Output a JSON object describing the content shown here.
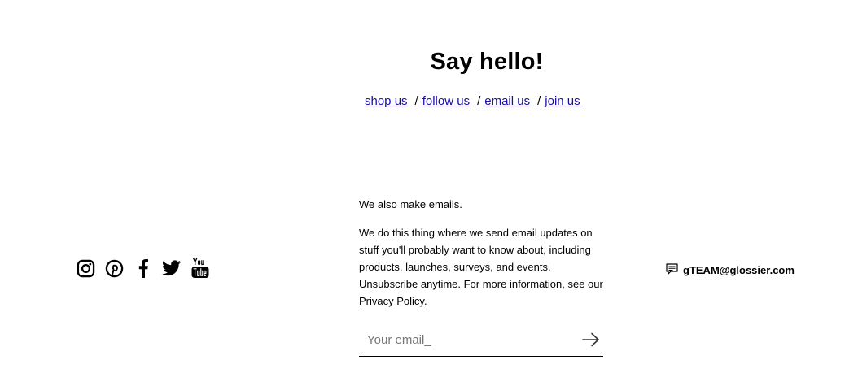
{
  "heading": "Say hello!",
  "nav": {
    "items": [
      {
        "label": "shop us"
      },
      {
        "label": "follow us"
      },
      {
        "label": "email us"
      },
      {
        "label": "join us"
      }
    ],
    "separator": "/"
  },
  "social": {
    "icons": [
      "instagram-icon",
      "pinterest-icon",
      "facebook-icon",
      "twitter-icon",
      "youtube-icon"
    ]
  },
  "newsletter": {
    "intro": "We also make emails.",
    "body": "We do this thing where we send email updates on stuff you'll probably want to know about, including products, launches, surveys, and events. Unsubscribe anytime. For more information, see our",
    "privacy_link": "Privacy Policy",
    "period": ".",
    "email_placeholder": "Your email_",
    "submit_icon": "arrow-right-icon"
  },
  "contact": {
    "icon": "message-icon",
    "email": "gTEAM@glossier.com"
  }
}
